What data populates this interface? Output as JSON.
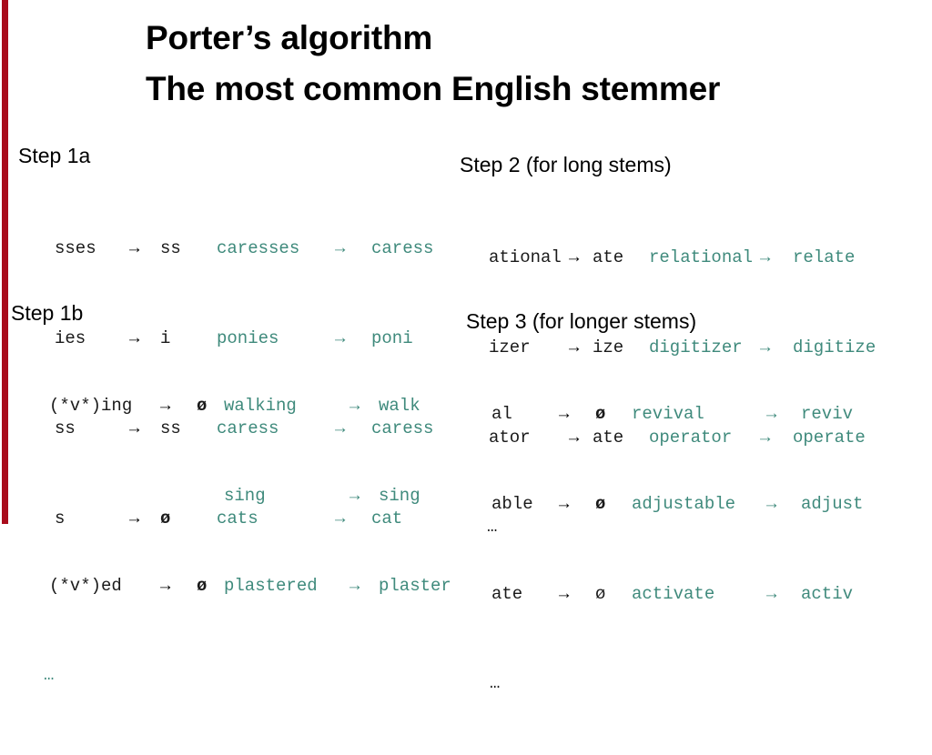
{
  "slide": {
    "title_line1": "Porter’s algorithm",
    "title_line2": "The most common English stemmer",
    "accent_color": "#a90c1c",
    "example_color": "#3f8a7c",
    "rule_color": "#1a1a1a",
    "background": "#ffffff"
  },
  "arrow": "→",
  "null_symbol": "ø",
  "ellipsis": "…",
  "sections": [
    {
      "id": "step-1a",
      "heading": "Step 1a",
      "has_ellipsis": false,
      "rows": [
        {
          "pattern": "sses",
          "arrow1": "→",
          "result": "ss",
          "example": "caresses",
          "arrow2": "→",
          "stem": "caress"
        },
        {
          "pattern": "ies",
          "arrow1": "→",
          "result": "i",
          "example": "ponies",
          "arrow2": "→",
          "stem": "poni"
        },
        {
          "pattern": "ss",
          "arrow1": "→",
          "result": "ss",
          "example": "caress",
          "arrow2": "→",
          "stem": "caress"
        },
        {
          "pattern": "s",
          "arrow1": "→",
          "result": "ø",
          "example": "cats",
          "arrow2": "→",
          "stem": "cat"
        }
      ]
    },
    {
      "id": "step-1b",
      "heading": "Step 1b",
      "has_ellipsis": true,
      "ellipsis_color": "teal",
      "rows": [
        {
          "pattern": "(*v*)ing",
          "arrow1": "→",
          "result": "ø",
          "example": "walking",
          "arrow2": "→",
          "stem": "walk"
        },
        {
          "pattern": "",
          "arrow1": "",
          "result": "",
          "example": "sing",
          "arrow2": "→",
          "stem": "sing"
        },
        {
          "pattern": "(*v*)ed",
          "arrow1": "→",
          "result": "ø",
          "example": "plastered",
          "arrow2": "→",
          "stem": "plaster"
        }
      ]
    },
    {
      "id": "step-2",
      "heading": "Step 2 (for long stems)",
      "has_ellipsis": true,
      "ellipsis_color": "dark",
      "rows": [
        {
          "pattern": "ational",
          "arrow1": "→",
          "result": "ate",
          "example": "relational",
          "arrow2": "→",
          "stem": "relate"
        },
        {
          "pattern": "izer",
          "arrow1": "→",
          "result": "ize",
          "example": "digitizer",
          "arrow2": "→",
          "stem": "digitize"
        },
        {
          "pattern": "ator",
          "arrow1": "→",
          "result": "ate",
          "example": "operator",
          "arrow2": "→",
          "stem": "operate"
        }
      ]
    },
    {
      "id": "step-3",
      "heading": "Step 3 (for longer stems)",
      "has_ellipsis": true,
      "ellipsis_color": "dark",
      "rows": [
        {
          "pattern": "al",
          "arrow1": "→",
          "result": "ø",
          "example": "revival",
          "arrow2": "→",
          "stem": "reviv"
        },
        {
          "pattern": "able",
          "arrow1": "→",
          "result": "ø",
          "example": "adjustable",
          "arrow2": "→",
          "stem": "adjust"
        },
        {
          "pattern": "ate",
          "arrow1": "→",
          "result": "ø",
          "example": "activate",
          "arrow2": "→",
          "stem": "activ"
        }
      ]
    }
  ]
}
